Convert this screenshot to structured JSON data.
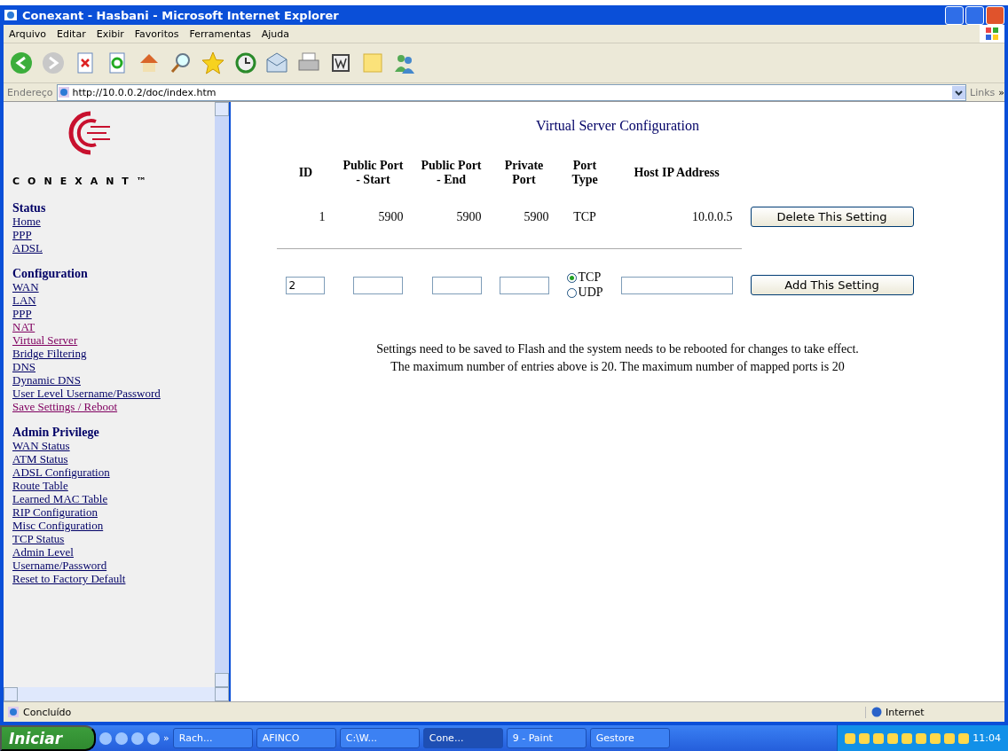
{
  "window": {
    "title": "Conexant - Hasbani - Microsoft Internet Explorer"
  },
  "menu": [
    "Arquivo",
    "Editar",
    "Exibir",
    "Favoritos",
    "Ferramentas",
    "Ajuda"
  ],
  "address": {
    "label": "Endereço",
    "url": "http://10.0.0.2/doc/index.htm",
    "links": "Links",
    "more": "»"
  },
  "sidebar": {
    "logo_text": "CONEXANT™",
    "sections": [
      {
        "heading": "Status",
        "items": [
          {
            "label": "Home",
            "visited": false
          },
          {
            "label": "PPP",
            "visited": false
          },
          {
            "label": "ADSL",
            "visited": false
          }
        ]
      },
      {
        "heading": "Configuration",
        "items": [
          {
            "label": "WAN",
            "visited": false
          },
          {
            "label": "LAN",
            "visited": false
          },
          {
            "label": "PPP",
            "visited": false
          },
          {
            "label": "NAT",
            "visited": true
          },
          {
            "label": "Virtual Server",
            "visited": true
          },
          {
            "label": "Bridge Filtering",
            "visited": false
          },
          {
            "label": "DNS",
            "visited": false
          },
          {
            "label": "Dynamic DNS",
            "visited": false
          },
          {
            "label": "User Level Username/Password",
            "visited": false
          },
          {
            "label": "Save Settings / Reboot",
            "visited": true
          }
        ]
      },
      {
        "heading": "Admin Privilege",
        "items": [
          {
            "label": "WAN Status",
            "visited": false
          },
          {
            "label": "ATM Status",
            "visited": false
          },
          {
            "label": "ADSL Configuration",
            "visited": false
          },
          {
            "label": "Route Table",
            "visited": false
          },
          {
            "label": "Learned MAC Table",
            "visited": false
          },
          {
            "label": "RIP Configuration",
            "visited": false
          },
          {
            "label": "Misc Configuration",
            "visited": false
          },
          {
            "label": "TCP Status",
            "visited": false
          },
          {
            "label": "Admin Level",
            "visited": false
          },
          {
            "label": "Username/Password",
            "visited": false
          },
          {
            "label": "Reset to Factory Default",
            "visited": false
          }
        ]
      }
    ]
  },
  "main": {
    "title": "Virtual Server Configuration",
    "columns": [
      "ID",
      "Public Port\n- Start",
      "Public Port\n- End",
      "Private\nPort",
      "Port\nType",
      "Host IP Address"
    ],
    "rows": [
      {
        "cells": [
          "1",
          "5900",
          "5900",
          "5900",
          "TCP",
          "10.0.0.5"
        ],
        "button": "Delete This Setting"
      }
    ],
    "new_entry": {
      "id_value": "2",
      "protocols": [
        {
          "label": "TCP",
          "selected": true
        },
        {
          "label": "UDP",
          "selected": false
        }
      ],
      "button": "Add This Setting"
    },
    "notes": [
      "Settings need to be saved to Flash and the system needs to be rebooted for changes to take effect.",
      "The maximum number of entries above is 20. The maximum number of mapped ports is 20"
    ]
  },
  "status_bar": {
    "text": "Concluído",
    "zone": "Internet"
  },
  "taskbar": {
    "start": "Iniciar",
    "more": "»",
    "items": [
      {
        "label": "Rach...",
        "selected": false
      },
      {
        "label": "AFINCO",
        "selected": false
      },
      {
        "label": "C:\\W...",
        "selected": false
      },
      {
        "label": "Cone...",
        "selected": true
      },
      {
        "label": "9 - Paint",
        "selected": false
      },
      {
        "label": "Gestore",
        "selected": false
      }
    ],
    "clock": "11:04"
  }
}
